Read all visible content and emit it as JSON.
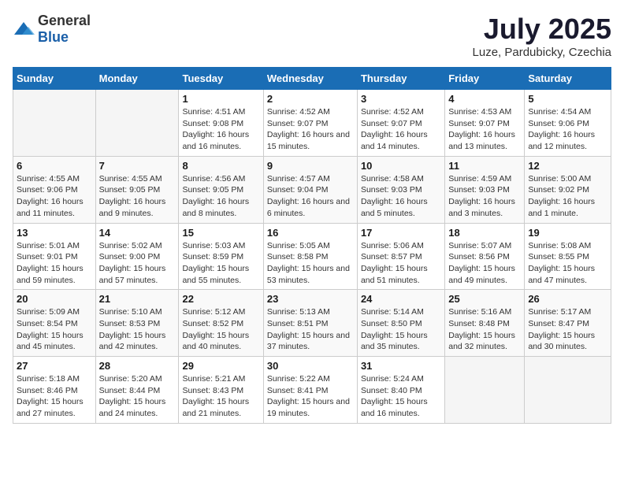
{
  "logo": {
    "general": "General",
    "blue": "Blue"
  },
  "title": "July 2025",
  "subtitle": "Luze, Pardubicky, Czechia",
  "days_of_week": [
    "Sunday",
    "Monday",
    "Tuesday",
    "Wednesday",
    "Thursday",
    "Friday",
    "Saturday"
  ],
  "weeks": [
    [
      {
        "day": "",
        "detail": ""
      },
      {
        "day": "",
        "detail": ""
      },
      {
        "day": "1",
        "detail": "Sunrise: 4:51 AM\nSunset: 9:08 PM\nDaylight: 16 hours and 16 minutes."
      },
      {
        "day": "2",
        "detail": "Sunrise: 4:52 AM\nSunset: 9:07 PM\nDaylight: 16 hours and 15 minutes."
      },
      {
        "day": "3",
        "detail": "Sunrise: 4:52 AM\nSunset: 9:07 PM\nDaylight: 16 hours and 14 minutes."
      },
      {
        "day": "4",
        "detail": "Sunrise: 4:53 AM\nSunset: 9:07 PM\nDaylight: 16 hours and 13 minutes."
      },
      {
        "day": "5",
        "detail": "Sunrise: 4:54 AM\nSunset: 9:06 PM\nDaylight: 16 hours and 12 minutes."
      }
    ],
    [
      {
        "day": "6",
        "detail": "Sunrise: 4:55 AM\nSunset: 9:06 PM\nDaylight: 16 hours and 11 minutes."
      },
      {
        "day": "7",
        "detail": "Sunrise: 4:55 AM\nSunset: 9:05 PM\nDaylight: 16 hours and 9 minutes."
      },
      {
        "day": "8",
        "detail": "Sunrise: 4:56 AM\nSunset: 9:05 PM\nDaylight: 16 hours and 8 minutes."
      },
      {
        "day": "9",
        "detail": "Sunrise: 4:57 AM\nSunset: 9:04 PM\nDaylight: 16 hours and 6 minutes."
      },
      {
        "day": "10",
        "detail": "Sunrise: 4:58 AM\nSunset: 9:03 PM\nDaylight: 16 hours and 5 minutes."
      },
      {
        "day": "11",
        "detail": "Sunrise: 4:59 AM\nSunset: 9:03 PM\nDaylight: 16 hours and 3 minutes."
      },
      {
        "day": "12",
        "detail": "Sunrise: 5:00 AM\nSunset: 9:02 PM\nDaylight: 16 hours and 1 minute."
      }
    ],
    [
      {
        "day": "13",
        "detail": "Sunrise: 5:01 AM\nSunset: 9:01 PM\nDaylight: 15 hours and 59 minutes."
      },
      {
        "day": "14",
        "detail": "Sunrise: 5:02 AM\nSunset: 9:00 PM\nDaylight: 15 hours and 57 minutes."
      },
      {
        "day": "15",
        "detail": "Sunrise: 5:03 AM\nSunset: 8:59 PM\nDaylight: 15 hours and 55 minutes."
      },
      {
        "day": "16",
        "detail": "Sunrise: 5:05 AM\nSunset: 8:58 PM\nDaylight: 15 hours and 53 minutes."
      },
      {
        "day": "17",
        "detail": "Sunrise: 5:06 AM\nSunset: 8:57 PM\nDaylight: 15 hours and 51 minutes."
      },
      {
        "day": "18",
        "detail": "Sunrise: 5:07 AM\nSunset: 8:56 PM\nDaylight: 15 hours and 49 minutes."
      },
      {
        "day": "19",
        "detail": "Sunrise: 5:08 AM\nSunset: 8:55 PM\nDaylight: 15 hours and 47 minutes."
      }
    ],
    [
      {
        "day": "20",
        "detail": "Sunrise: 5:09 AM\nSunset: 8:54 PM\nDaylight: 15 hours and 45 minutes."
      },
      {
        "day": "21",
        "detail": "Sunrise: 5:10 AM\nSunset: 8:53 PM\nDaylight: 15 hours and 42 minutes."
      },
      {
        "day": "22",
        "detail": "Sunrise: 5:12 AM\nSunset: 8:52 PM\nDaylight: 15 hours and 40 minutes."
      },
      {
        "day": "23",
        "detail": "Sunrise: 5:13 AM\nSunset: 8:51 PM\nDaylight: 15 hours and 37 minutes."
      },
      {
        "day": "24",
        "detail": "Sunrise: 5:14 AM\nSunset: 8:50 PM\nDaylight: 15 hours and 35 minutes."
      },
      {
        "day": "25",
        "detail": "Sunrise: 5:16 AM\nSunset: 8:48 PM\nDaylight: 15 hours and 32 minutes."
      },
      {
        "day": "26",
        "detail": "Sunrise: 5:17 AM\nSunset: 8:47 PM\nDaylight: 15 hours and 30 minutes."
      }
    ],
    [
      {
        "day": "27",
        "detail": "Sunrise: 5:18 AM\nSunset: 8:46 PM\nDaylight: 15 hours and 27 minutes."
      },
      {
        "day": "28",
        "detail": "Sunrise: 5:20 AM\nSunset: 8:44 PM\nDaylight: 15 hours and 24 minutes."
      },
      {
        "day": "29",
        "detail": "Sunrise: 5:21 AM\nSunset: 8:43 PM\nDaylight: 15 hours and 21 minutes."
      },
      {
        "day": "30",
        "detail": "Sunrise: 5:22 AM\nSunset: 8:41 PM\nDaylight: 15 hours and 19 minutes."
      },
      {
        "day": "31",
        "detail": "Sunrise: 5:24 AM\nSunset: 8:40 PM\nDaylight: 15 hours and 16 minutes."
      },
      {
        "day": "",
        "detail": ""
      },
      {
        "day": "",
        "detail": ""
      }
    ]
  ]
}
